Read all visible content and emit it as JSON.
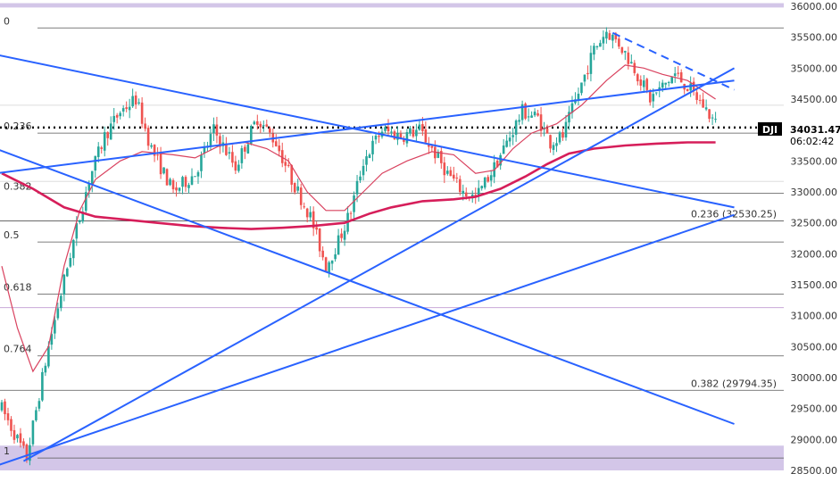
{
  "chart_data": {
    "type": "candlestick",
    "symbol": "DJI",
    "last_price": "34031.47",
    "countdown": "06:02:42",
    "y_axis": {
      "min": 28500,
      "max": 36050,
      "ticks": [
        36000,
        35500,
        35000,
        34500,
        34000,
        33500,
        33000,
        32500,
        32000,
        31500,
        31000,
        30500,
        30000,
        29500,
        29000,
        28500
      ],
      "tick_labels": [
        "36000.00",
        "35500.00",
        "35000.00",
        "34500.00",
        "34000.00",
        "33500.00",
        "33000.00",
        "32500.00",
        "32000.00",
        "31500.00",
        "31000.00",
        "30500.00",
        "30000.00",
        "29500.00",
        "29000.00",
        "28500.00"
      ]
    },
    "x_bars": 240,
    "price_path": [
      [
        0,
        29500
      ],
      [
        8,
        28700
      ],
      [
        15,
        30500
      ],
      [
        22,
        32000
      ],
      [
        28,
        33200
      ],
      [
        33,
        33900
      ],
      [
        38,
        34300
      ],
      [
        43,
        34500
      ],
      [
        48,
        33700
      ],
      [
        55,
        33000
      ],
      [
        62,
        33300
      ],
      [
        68,
        34000
      ],
      [
        75,
        33400
      ],
      [
        82,
        34200
      ],
      [
        88,
        33800
      ],
      [
        93,
        33200
      ],
      [
        99,
        32600
      ],
      [
        104,
        31800
      ],
      [
        108,
        32200
      ],
      [
        112,
        32700
      ],
      [
        116,
        33500
      ],
      [
        122,
        34000
      ],
      [
        128,
        33900
      ],
      [
        134,
        34000
      ],
      [
        138,
        33700
      ],
      [
        143,
        33300
      ],
      [
        148,
        33000
      ],
      [
        152,
        32900
      ],
      [
        158,
        33400
      ],
      [
        163,
        33900
      ],
      [
        167,
        34300
      ],
      [
        172,
        34200
      ],
      [
        176,
        33800
      ],
      [
        180,
        33900
      ],
      [
        185,
        34600
      ],
      [
        190,
        35300
      ],
      [
        194,
        35600
      ],
      [
        198,
        35400
      ],
      [
        203,
        35000
      ],
      [
        208,
        34500
      ],
      [
        212,
        34700
      ],
      [
        216,
        34900
      ],
      [
        220,
        34700
      ],
      [
        225,
        34400
      ],
      [
        229,
        34100
      ]
    ],
    "series": [
      {
        "name": "",
        "kind": "sma",
        "color": "#d9425f",
        "points": [
          [
            0,
            31800
          ],
          [
            5,
            30800
          ],
          [
            10,
            30100
          ],
          [
            15,
            30500
          ],
          [
            20,
            31800
          ],
          [
            25,
            32700
          ],
          [
            30,
            33200
          ],
          [
            38,
            33500
          ],
          [
            45,
            33650
          ],
          [
            55,
            33600
          ],
          [
            62,
            33550
          ],
          [
            70,
            33750
          ],
          [
            78,
            33800
          ],
          [
            85,
            33700
          ],
          [
            92,
            33500
          ],
          [
            98,
            33000
          ],
          [
            104,
            32700
          ],
          [
            110,
            32700
          ],
          [
            116,
            33000
          ],
          [
            122,
            33300
          ],
          [
            130,
            33500
          ],
          [
            138,
            33650
          ],
          [
            145,
            33600
          ],
          [
            152,
            33300
          ],
          [
            158,
            33350
          ],
          [
            164,
            33700
          ],
          [
            170,
            33950
          ],
          [
            178,
            34100
          ],
          [
            186,
            34400
          ],
          [
            194,
            34800
          ],
          [
            200,
            35050
          ],
          [
            206,
            35000
          ],
          [
            212,
            34900
          ],
          [
            220,
            34800
          ],
          [
            229,
            34500
          ]
        ]
      },
      {
        "name": "",
        "kind": "sma",
        "color": "#d61e5a",
        "points": [
          [
            0,
            33300
          ],
          [
            10,
            33050
          ],
          [
            20,
            32750
          ],
          [
            30,
            32600
          ],
          [
            40,
            32550
          ],
          [
            50,
            32500
          ],
          [
            60,
            32450
          ],
          [
            70,
            32420
          ],
          [
            80,
            32400
          ],
          [
            90,
            32420
          ],
          [
            100,
            32450
          ],
          [
            110,
            32500
          ],
          [
            118,
            32650
          ],
          [
            125,
            32750
          ],
          [
            135,
            32850
          ],
          [
            145,
            32880
          ],
          [
            152,
            32920
          ],
          [
            160,
            33050
          ],
          [
            168,
            33250
          ],
          [
            175,
            33450
          ],
          [
            182,
            33620
          ],
          [
            190,
            33700
          ],
          [
            200,
            33750
          ],
          [
            210,
            33780
          ],
          [
            220,
            33800
          ],
          [
            229,
            33800
          ]
        ]
      }
    ],
    "trendlines": [
      {
        "from": [
          -2,
          35220
        ],
        "to": [
          235,
          32750
        ],
        "style": "solid"
      },
      {
        "from": [
          -2,
          33300
        ],
        "to": [
          235,
          34800
        ],
        "style": "solid"
      },
      {
        "from": [
          -2,
          33700
        ],
        "to": [
          235,
          29250
        ],
        "style": "solid"
      },
      {
        "from": [
          -2,
          28570
        ],
        "to": [
          235,
          32630
        ],
        "style": "solid"
      },
      {
        "from": [
          7,
          28650
        ],
        "to": [
          235,
          35000
        ],
        "style": "solid"
      },
      {
        "from": [
          196,
          35570
        ],
        "to": [
          235,
          34650
        ],
        "style": "dashed"
      }
    ],
    "fib_levels_left": [
      {
        "label": "0",
        "price": 35650
      },
      {
        "label": "0.236",
        "price": 33950
      },
      {
        "label": "0.382",
        "price": 32980
      },
      {
        "label": "0.5",
        "price": 32190
      },
      {
        "label": "0.618",
        "price": 31350
      },
      {
        "label": "0.764",
        "price": 30350
      },
      {
        "label": "1",
        "price": 28700
      }
    ],
    "fib_levels_right": [
      {
        "label": "0.236 (32530.25)",
        "price": 32530.25
      },
      {
        "label": "0.382 (29794.35)",
        "price": 29794.35
      }
    ],
    "horizontal_lines": [
      {
        "price": 34040,
        "style": "dotted",
        "color": "#000000"
      },
      {
        "price": 31130,
        "style": "solid",
        "color": "#c9a8d8"
      },
      {
        "price": 33170,
        "style": "solid",
        "color": "#dddddd"
      },
      {
        "price": 34400,
        "style": "solid",
        "color": "#dddddd"
      }
    ],
    "zones": [
      {
        "from": 35980,
        "to": 36050,
        "color": "#d3c6e8"
      },
      {
        "from": 28500,
        "to": 28900,
        "color": "#d3c6e8"
      }
    ],
    "colors": {
      "up": "#26a69a",
      "down": "#ef5350",
      "trend": "#2962ff",
      "fib_line": "#555555",
      "axis_text": "#333333"
    }
  }
}
